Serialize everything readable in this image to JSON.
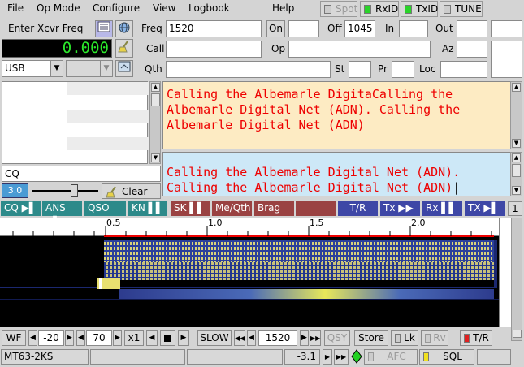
{
  "menu": {
    "file": "File",
    "opmode": "Op Mode",
    "configure": "Configure",
    "view": "View",
    "logbook": "Logbook",
    "help": "Help"
  },
  "toggles": {
    "spot": "Spot",
    "rxid": "RxID",
    "txid": "TxID",
    "tune": "TUNE"
  },
  "xcvr": {
    "label": "Enter Xcvr Freq",
    "freq_display": "0.000",
    "mode": "USB"
  },
  "log": {
    "freq_label": "Freq",
    "freq_value": "1520",
    "on_label": "On",
    "off_label": "Off",
    "off_value": "1045",
    "in_label": "In",
    "out_label": "Out",
    "call_label": "Call",
    "op_label": "Op",
    "az_label": "Az",
    "qth_label": "Qth",
    "st_label": "St",
    "pr_label": "Pr",
    "loc_label": "Loc"
  },
  "rx_text": "Calling the Albemarle DigitaCalling the Albemarle Digital Net (ADN).  Calling the Albemarle Digital Net (ADN)",
  "tx_text": "Calling the Albemarle Digital Net (ADN).\nCalling the Albemarle Digital Net (ADN)",
  "left_panel": {
    "search_value": "CQ",
    "squelch_value": "3.0",
    "clear_label": "Clear"
  },
  "macros": [
    "CQ",
    "ANS",
    "QSO",
    "KN",
    "SK",
    "Me/Qth",
    "Brag",
    "",
    "T/R",
    "Tx",
    "Rx",
    "TX"
  ],
  "macro_page": "1",
  "waterfall": {
    "scale_labels": [
      "0.5",
      "1.0",
      "1.5",
      "2.0"
    ]
  },
  "controls": {
    "wf_label": "WF",
    "ref_level": "-20",
    "range": "70",
    "zoom": "x1",
    "speed": "SLOW",
    "carrier": "1520",
    "qsy": "QSY",
    "store": "Store",
    "lk": "Lk",
    "rv": "Rv",
    "tr": "T/R"
  },
  "statusbar": {
    "mode": "MT63-2KS",
    "snr": "-3.1",
    "afc": "AFC",
    "sql": "SQL"
  }
}
